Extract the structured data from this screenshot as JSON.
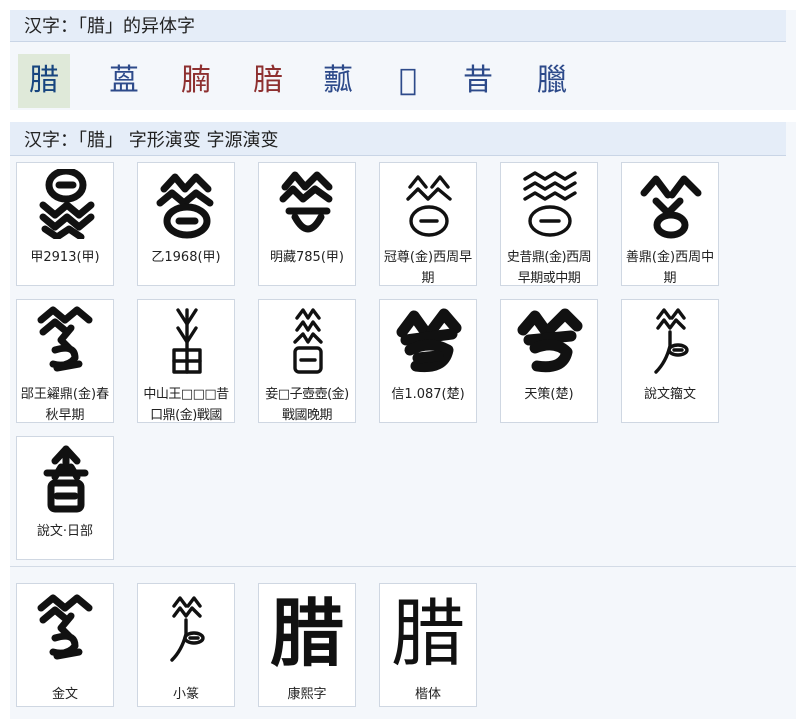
{
  "variants": {
    "title": "汉字：「腊」的异体字",
    "items": [
      {
        "char": "腊",
        "style": "current"
      },
      {
        "char": "蒕",
        "style": "blue"
      },
      {
        "char": "腩",
        "style": "red"
      },
      {
        "char": "腤",
        "style": "red"
      },
      {
        "char": "䕯",
        "style": "blue"
      },
      {
        "char": "𦓤",
        "style": "blue"
      },
      {
        "char": "昔",
        "style": "blue"
      },
      {
        "char": "臘",
        "style": "blue"
      }
    ]
  },
  "evolution": {
    "title": "汉字：「腊」 字形演变 字源演变",
    "tiles": [
      {
        "label": "甲2913(甲)",
        "glyph": "oracle-glyph-1"
      },
      {
        "label": "乙1968(甲)",
        "glyph": "oracle-glyph-2"
      },
      {
        "label": "明藏785(甲)",
        "glyph": "oracle-glyph-3"
      },
      {
        "label": "冠尊(金)西周早期",
        "glyph": "bronze-glyph-1"
      },
      {
        "label": "史昔鼎(金)西周早期或中期",
        "glyph": "bronze-glyph-2"
      },
      {
        "label": "善鼎(金)西周中期",
        "glyph": "bronze-glyph-3"
      },
      {
        "label": "郘王糴鼎(金)春秋早期",
        "glyph": "bronze-glyph-4"
      },
      {
        "label": "中山王□□□昔口鼎(金)戰國",
        "glyph": "bronze-glyph-5"
      },
      {
        "label": "妾□子壺壺(金)戰國晚期",
        "glyph": "bronze-glyph-6"
      },
      {
        "label": "信1.087(楚)",
        "glyph": "chu-glyph-1"
      },
      {
        "label": "天策(楚)",
        "glyph": "chu-glyph-2"
      },
      {
        "label": "說文籀文",
        "glyph": "shuowen-zhouwen-glyph"
      },
      {
        "label": "說文·日部",
        "glyph": "shuowen-ri-glyph"
      }
    ],
    "final": [
      {
        "label": "金文",
        "glyph": "jinwen-glyph"
      },
      {
        "label": "小篆",
        "glyph": "seal-glyph"
      },
      {
        "label": "康熙字",
        "char": "腊"
      },
      {
        "label": "楷体",
        "char": "腊"
      }
    ]
  }
}
